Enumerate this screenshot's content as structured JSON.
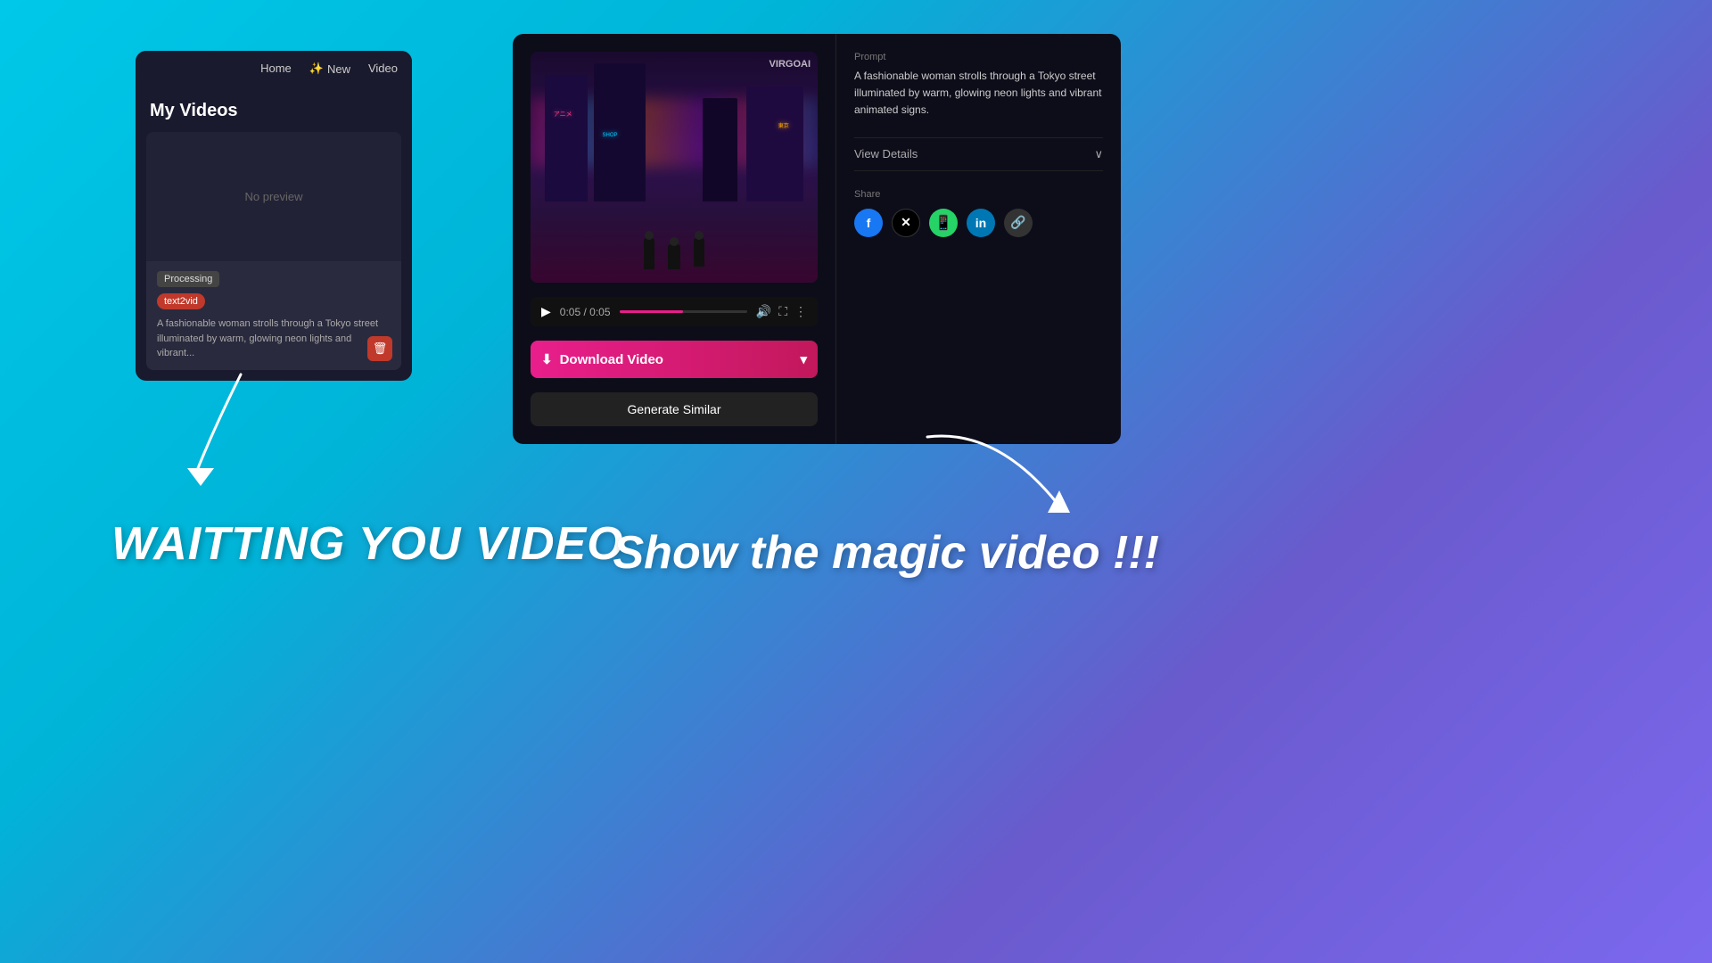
{
  "background": {
    "gradient_start": "#00c8e8",
    "gradient_end": "#7b68ee"
  },
  "left_panel": {
    "nav": {
      "home": "Home",
      "new": "New",
      "video": "Video"
    },
    "title": "My Videos",
    "video_card": {
      "preview_text": "No preview",
      "status": "Processing",
      "tag": "text2vid",
      "description": "A fashionable woman strolls through a Tokyo street illuminated by warm, glowing neon lights and vibrant..."
    },
    "delete_icon": "🗑"
  },
  "right_panel": {
    "prompt_label": "Prompt",
    "prompt_text": "A fashionable woman strolls through a Tokyo street illuminated by warm, glowing neon lights and vibrant animated signs.",
    "view_details_label": "View Details",
    "video_time": "0:05 / 0:05",
    "share_label": "Share",
    "download_btn": "Download Video",
    "generate_btn": "Generate Similar",
    "watermark": "VIRGOAI"
  },
  "bottom_texts": {
    "left": "WAITTING YOU VIDEO",
    "right": "Show the magic video !!!"
  },
  "arrows": {
    "left_arrow_label": "arrow pointing down-left",
    "right_arrow_label": "arrow pointing down-right"
  }
}
